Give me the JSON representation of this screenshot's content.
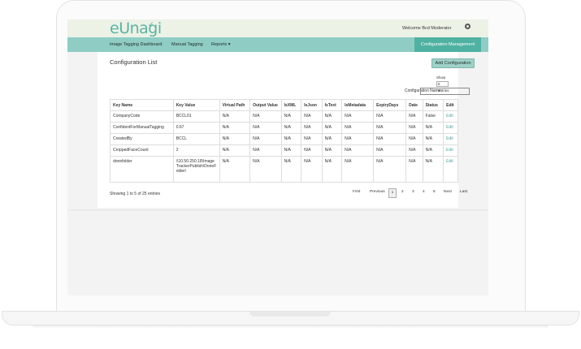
{
  "header": {
    "logo_text": "eUnagi",
    "welcome_text": "Welcome Bcd Moderator"
  },
  "nav": {
    "items": [
      {
        "label": "Image Tagging Dashboard"
      },
      {
        "label": "Manual Tagging"
      },
      {
        "label": "Reports ▾"
      }
    ],
    "active_label": "Configuration Management"
  },
  "page": {
    "title": "Configuration List",
    "add_button": "Add Configuration",
    "show_label": "Show",
    "page_size": "5",
    "entries_label": "entries",
    "filter_label": "Configuration Name:",
    "filter_value": ""
  },
  "table": {
    "columns": [
      "Key Name",
      "Key Value",
      "Virtual Path",
      "Output Value",
      "IsXML",
      "IsJson",
      "IsText",
      "IsMetadata",
      "ExpiryDays",
      "Date",
      "Status",
      "Edit"
    ],
    "rows": [
      [
        "CompanyCode",
        "BCCL01",
        "N/A",
        "N/A",
        "N/A",
        "N/A",
        "N/A",
        "N/A",
        "N/A",
        "N/A",
        "False",
        "Edit"
      ],
      [
        "ConfidentForManualTagging",
        "0.67",
        "N/A",
        "N/A",
        "N/A",
        "N/A",
        "N/A",
        "N/A",
        "N/A",
        "N/A",
        "N/A",
        "Edit"
      ],
      [
        "CreatedBy",
        "BCCL",
        "N/A",
        "N/A",
        "N/A",
        "N/A",
        "N/A",
        "N/A",
        "N/A",
        "N/A",
        "N/A",
        "Edit"
      ],
      [
        "CroppedFaceCount",
        "2",
        "N/A",
        "N/A",
        "N/A",
        "N/A",
        "N/A",
        "N/A",
        "N/A",
        "N/A",
        "N/A",
        "Edit"
      ],
      [
        "donefolder",
        "\\\\10.50.250.18\\ImageTrackerPublish\\DoneFolder\\",
        "N/A",
        "N/A",
        "N/A",
        "N/A",
        "N/A",
        "N/A",
        "N/A",
        "N/A",
        "N/A",
        "Edit"
      ]
    ]
  },
  "footer": {
    "showing": "Showing 1 to 5 of 25 entries",
    "pager": [
      "First",
      "Previous",
      "1",
      "2",
      "3",
      "4",
      "5",
      "Next",
      "Last"
    ],
    "active_page": "1"
  },
  "colors": {
    "nav_bg": "#8fcdc4",
    "active_nav_bg": "#4fb1a1",
    "header_bg": "#ecf2e6",
    "button_bg": "#9fd1c7",
    "link": "#4fa8a0"
  }
}
